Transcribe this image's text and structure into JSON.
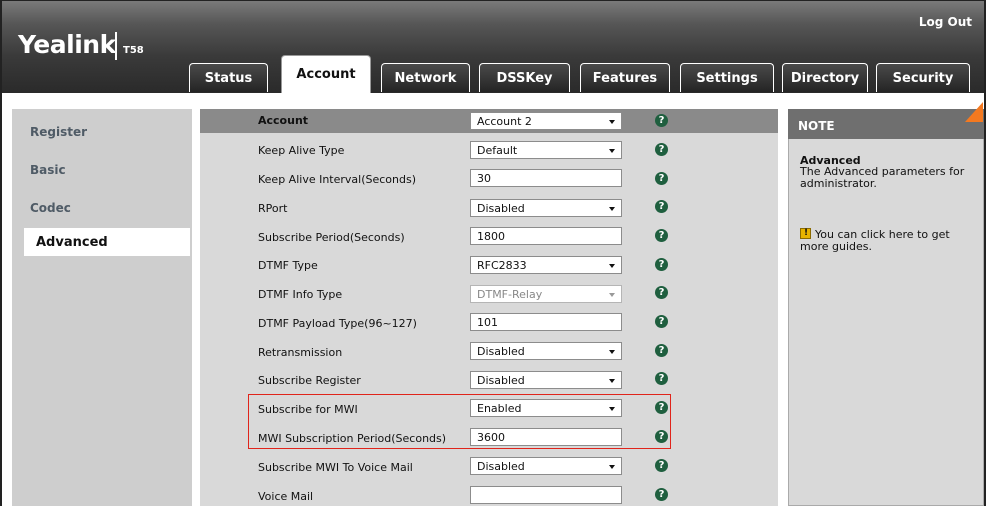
{
  "header": {
    "brand": "Yealink",
    "model": "T58",
    "logout": "Log Out"
  },
  "tabs": [
    {
      "label": "Status"
    },
    {
      "label": "Account"
    },
    {
      "label": "Network"
    },
    {
      "label": "DSSKey"
    },
    {
      "label": "Features"
    },
    {
      "label": "Settings"
    },
    {
      "label": "Directory"
    },
    {
      "label": "Security"
    }
  ],
  "active_tab": "Account",
  "sidebar": {
    "items": [
      {
        "label": "Register"
      },
      {
        "label": "Basic"
      },
      {
        "label": "Codec"
      },
      {
        "label": "Advanced"
      }
    ],
    "active": "Advanced"
  },
  "form": {
    "rows": [
      {
        "label": "Account",
        "value": "Account 2",
        "type": "select"
      },
      {
        "label": "Keep Alive Type",
        "value": "Default",
        "type": "select"
      },
      {
        "label": "Keep Alive Interval(Seconds)",
        "value": "30",
        "type": "input"
      },
      {
        "label": "RPort",
        "value": "Disabled",
        "type": "select"
      },
      {
        "label": "Subscribe Period(Seconds)",
        "value": "1800",
        "type": "input"
      },
      {
        "label": "DTMF Type",
        "value": "RFC2833",
        "type": "select"
      },
      {
        "label": "DTMF Info Type",
        "value": "DTMF-Relay",
        "type": "select-disabled"
      },
      {
        "label": "DTMF Payload Type(96~127)",
        "value": "101",
        "type": "input"
      },
      {
        "label": "Retransmission",
        "value": "Disabled",
        "type": "select"
      },
      {
        "label": "Subscribe Register",
        "value": "Disabled",
        "type": "select"
      },
      {
        "label": "Subscribe for MWI",
        "value": "Enabled",
        "type": "select"
      },
      {
        "label": "MWI Subscription Period(Seconds)",
        "value": "3600",
        "type": "input"
      },
      {
        "label": "Subscribe MWI To Voice Mail",
        "value": "Disabled",
        "type": "select"
      },
      {
        "label": "Voice Mail",
        "value": "",
        "type": "input"
      }
    ],
    "help_glyph": "?"
  },
  "note": {
    "title": "NOTE",
    "heading": "Advanced",
    "description": "The Advanced parameters for administrator.",
    "guide": "You can click here to get more guides."
  },
  "colors": {
    "highlight": "#e0241b",
    "help_icon": "#1f5f3f",
    "note_corner": "#f47920"
  }
}
